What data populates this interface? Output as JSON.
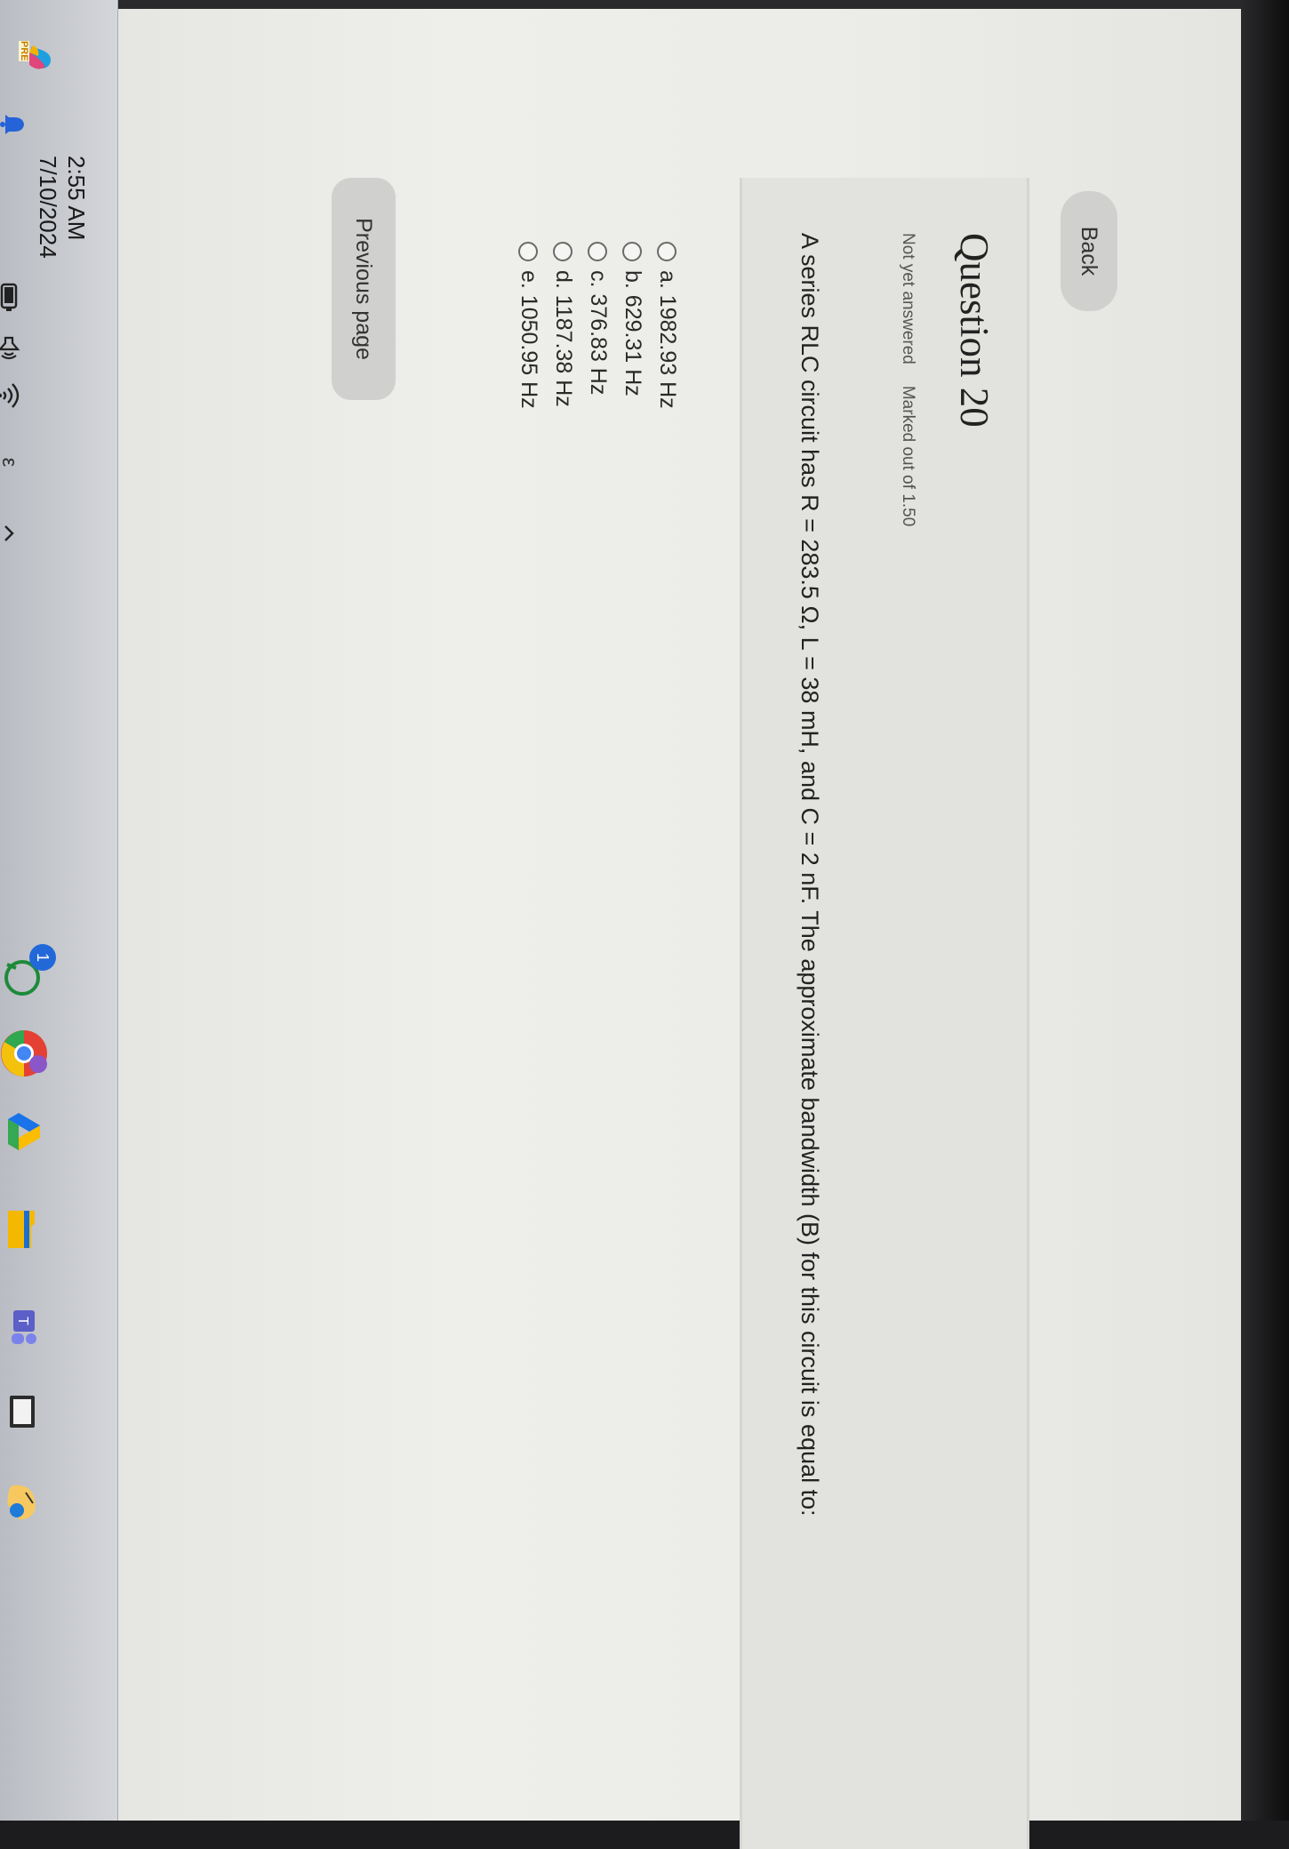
{
  "nav": {
    "back_label": "Back"
  },
  "question": {
    "title": "Question 20",
    "status": "Not yet answered",
    "marks": "Marked out of 1.50",
    "text": "A series RLC circuit has R = 283.5 Ω, L = 38 mH, and C = 2 nF. The approximate bandwidth (B) for this circuit is equal to:",
    "options": [
      "a. 1982.93 Hz",
      "b. 629.31 Hz",
      "c. 376.83 Hz",
      "d. 1187.38 Hz",
      "e. 1050.95 Hz"
    ]
  },
  "footer": {
    "previous_label": "Previous page"
  },
  "taskbar": {
    "time": "2:55 AM",
    "date": "7/10/2024",
    "notification_count": "1",
    "pre_label": "PRE"
  }
}
